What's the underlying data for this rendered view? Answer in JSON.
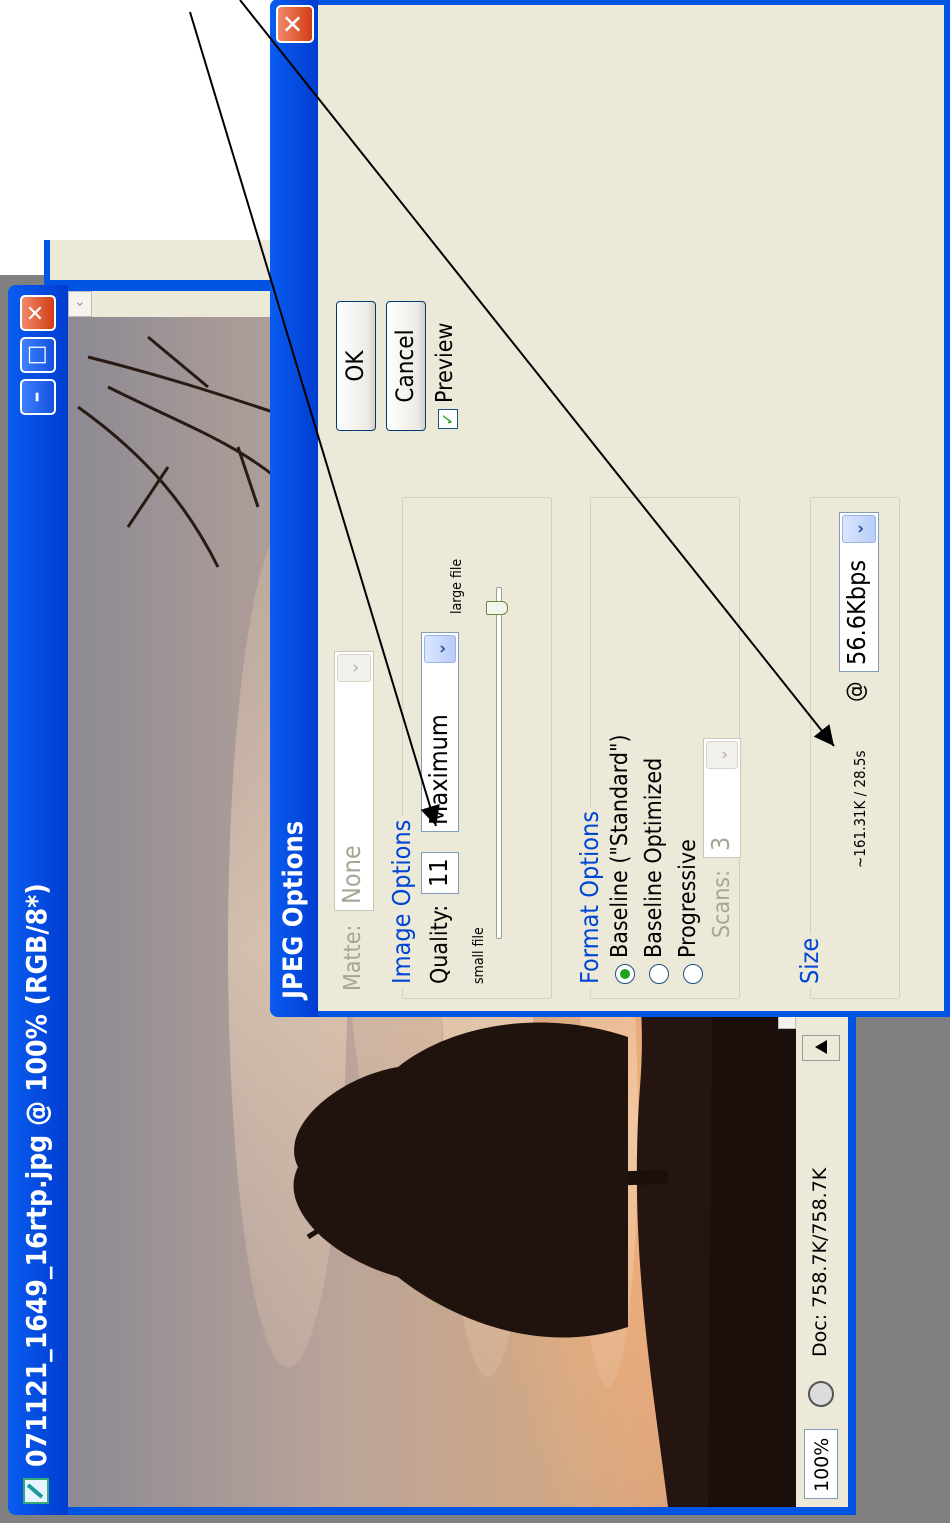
{
  "document_window": {
    "title": "071121_1649_16rtp.jpg @ 100% (RGB/8*)",
    "minimize_icon": "minimize-icon",
    "maximize_icon": "maximize-icon",
    "close_icon": "close-icon",
    "status": {
      "zoom": "100%",
      "doc_info": "Doc: 758.7K/758.7K"
    }
  },
  "jpeg_dialog": {
    "title": "JPEG Options",
    "matte": {
      "label": "Matte:",
      "value": "None"
    },
    "image_options": {
      "title": "Image Options",
      "quality_label": "Quality:",
      "quality_value": "11",
      "quality_preset": "Maximum",
      "small_file_label": "small file",
      "large_file_label": "large file",
      "slider_level": 0.92
    },
    "format_options": {
      "title": "Format Options",
      "options": [
        "Baseline (\"Standard\")",
        "Baseline Optimized",
        "Progressive"
      ],
      "selected": "Baseline (\"Standard\")",
      "scans_label": "Scans:",
      "scans_value": "3"
    },
    "size": {
      "title": "Size",
      "estimate": "~161.31K / 28.5s",
      "at_symbol": "@",
      "speed": "56.6Kbps"
    },
    "buttons": {
      "ok": "OK",
      "cancel": "Cancel"
    },
    "preview": {
      "label": "Preview",
      "checked": true
    }
  }
}
